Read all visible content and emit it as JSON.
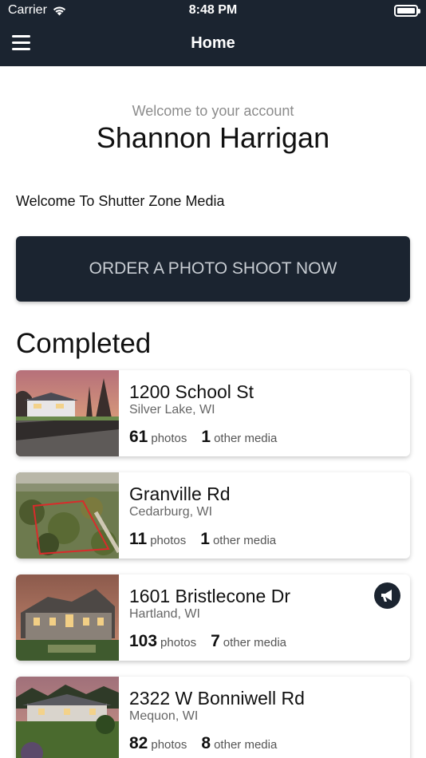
{
  "status_bar": {
    "carrier": "Carrier",
    "time": "8:48 PM"
  },
  "nav": {
    "title": "Home",
    "menu_icon": "hamburger-menu-icon"
  },
  "account": {
    "welcome": "Welcome to your account",
    "name": "Shannon Harrigan"
  },
  "message": "Welcome To Shutter Zone Media",
  "order_button": "ORDER A PHOTO SHOOT NOW",
  "section_title": "Completed",
  "listings": [
    {
      "address": "1200 School St",
      "city": "Silver Lake, WI",
      "photos": "61",
      "photos_label": "photos",
      "media": "1",
      "media_label": "other media"
    },
    {
      "address": "Granville Rd",
      "city": "Cedarburg, WI",
      "photos": "11",
      "photos_label": "photos",
      "media": "1",
      "media_label": "other media"
    },
    {
      "address": "1601 Bristlecone Dr",
      "city": "Hartland, WI",
      "photos": "103",
      "photos_label": "photos",
      "media": "7",
      "media_label": "other media",
      "badge_icon": "megaphone-icon"
    },
    {
      "address": "2322 W Bonniwell Rd",
      "city": "Mequon, WI",
      "photos": "82",
      "photos_label": "photos",
      "media": "8",
      "media_label": "other media"
    }
  ],
  "colors": {
    "header": "#1b2430",
    "button_text": "#c7ccd2"
  }
}
